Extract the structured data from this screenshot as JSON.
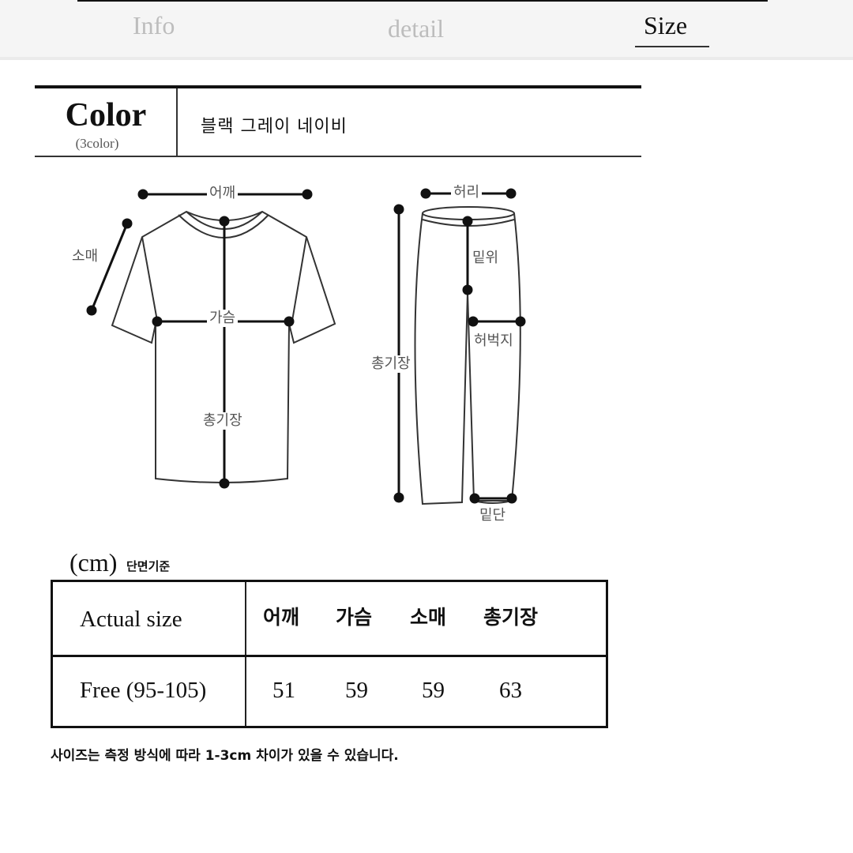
{
  "tabs": [
    {
      "label": "Info",
      "active": false
    },
    {
      "label": "detail",
      "active": false
    },
    {
      "label": "Size",
      "active": true
    }
  ],
  "color_section": {
    "title": "Color",
    "subtitle": "(3color)",
    "values": "블랙  그레이  네이비"
  },
  "diagram": {
    "top_labels": {
      "shoulder": "어깨",
      "sleeve": "소매",
      "chest": "가슴",
      "total_length": "총기장"
    },
    "pants_labels": {
      "waist": "허리",
      "rise": "밑위",
      "thigh": "허벅지",
      "total_length": "총기장",
      "hem": "밑단"
    }
  },
  "size_table": {
    "unit": "(cm)",
    "unit_note": "단면기준",
    "row_header_label": "Actual size",
    "columns": [
      "어깨",
      "가슴",
      "소매",
      "총기장"
    ],
    "rows": [
      {
        "size": "Free (95-105)",
        "values": [
          "51",
          "59",
          "59",
          "63"
        ]
      }
    ]
  },
  "footnote": "사이즈는 측정 방식에 따라 1-3cm 차이가 있을 수 있습니다."
}
